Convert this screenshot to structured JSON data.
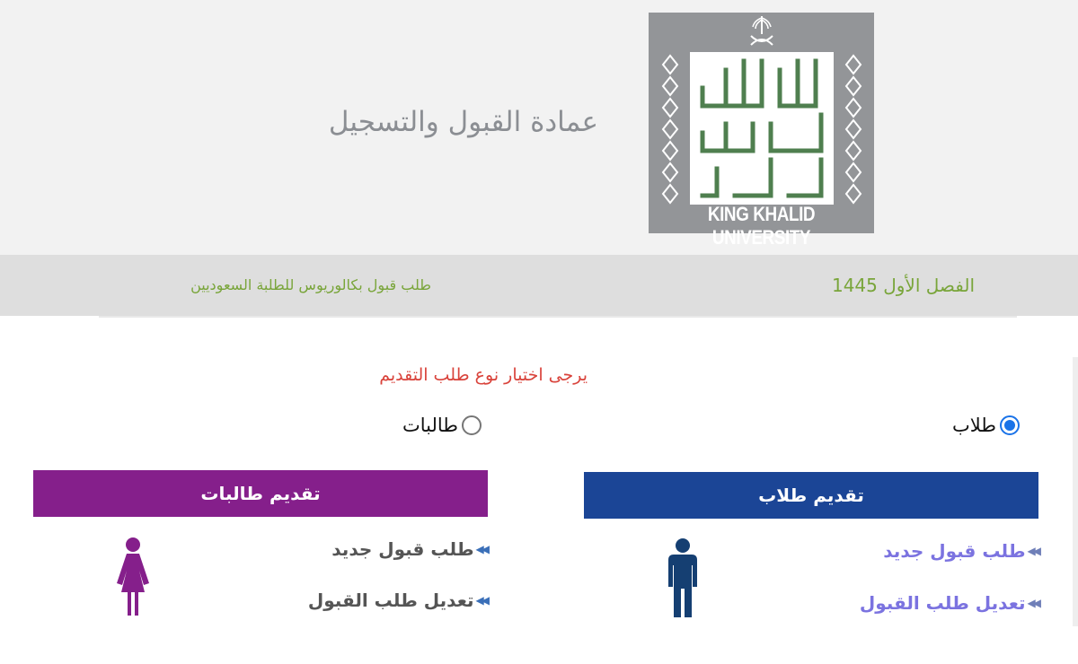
{
  "header": {
    "deanship_title": "عمادة القبول والتسجيل",
    "logo": {
      "arabic_text": "جامعة الملك خالد",
      "english_text": "KING KHALID UNIVERSITY",
      "background_color": "#939598",
      "arabic_color": "#4f7f4f",
      "emblem_icon": "saudi-emblem-icon"
    }
  },
  "info_bar": {
    "semester": "الفصل الأول 1445",
    "request_type": "طلب قبول بكالوريوس للطلبة السعوديين",
    "text_color": "#79a53a"
  },
  "form": {
    "prompt": "يرجى اختيار نوع طلب التقديم",
    "prompt_color": "#d9433b",
    "options": [
      {
        "label": "طلاب",
        "checked": true
      },
      {
        "label": "طالبات",
        "checked": false
      }
    ]
  },
  "panels": {
    "male": {
      "title": "تقديم طلاب",
      "color": "#1b4596",
      "links": [
        "طلب قبول جديد",
        "تعديل طلب القبول"
      ],
      "icon": "male-person-icon",
      "icon_color": "#153f72"
    },
    "female": {
      "title": "تقديم طالبات",
      "color": "#851f8b",
      "links": [
        "طلب قبول جديد",
        "تعديل طلب القبول"
      ],
      "icon": "female-person-icon",
      "icon_color": "#851f8b"
    }
  }
}
